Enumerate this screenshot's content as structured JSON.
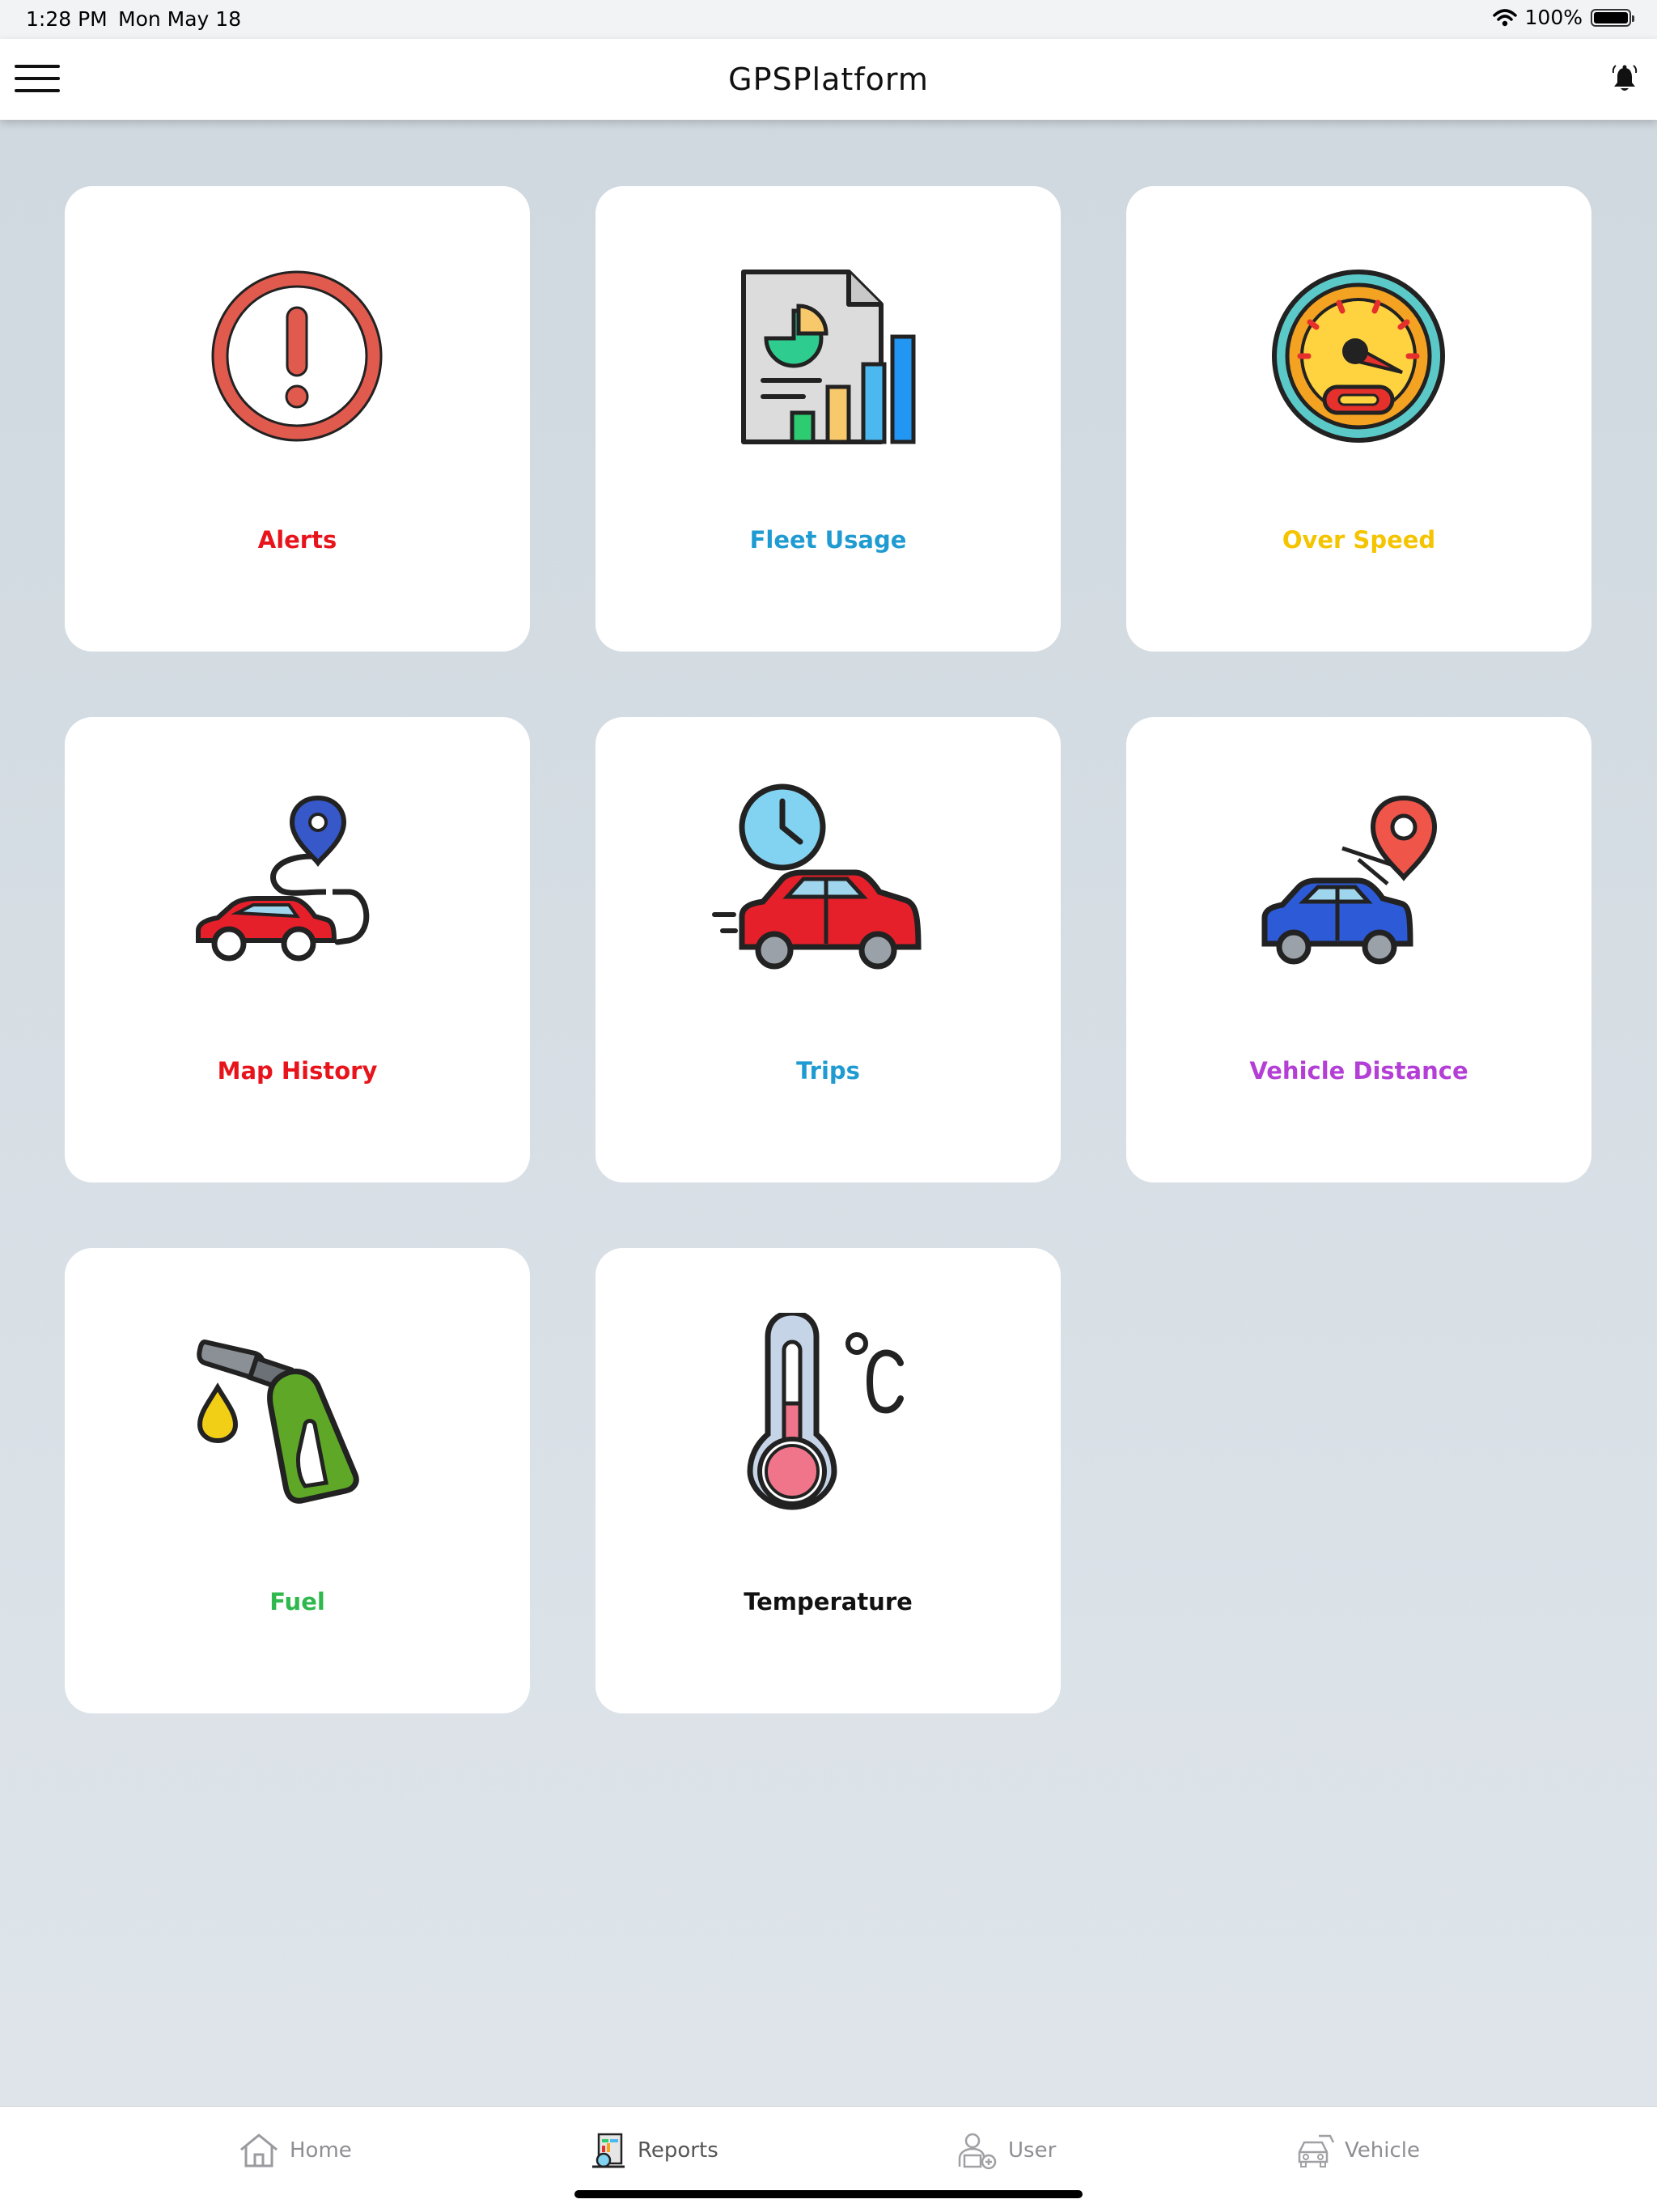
{
  "status_bar": {
    "time": "1:28 PM",
    "date": "Mon May 18",
    "battery": "100%"
  },
  "header": {
    "title": "GPSPlatform",
    "menu_icon": "hamburger-menu-icon",
    "bell_icon": "bell-icon"
  },
  "tiles": [
    {
      "label": "Alerts",
      "color": "#e8141c",
      "icon": "alert-icon"
    },
    {
      "label": "Fleet Usage",
      "color": "#1f9bd1",
      "icon": "report-chart-icon"
    },
    {
      "label": "Over Speed",
      "color": "#f5c400",
      "icon": "speedometer-icon"
    },
    {
      "label": "Map History",
      "color": "#e8141c",
      "icon": "car-route-icon"
    },
    {
      "label": "Trips",
      "color": "#1f9bd1",
      "icon": "car-clock-icon"
    },
    {
      "label": "Vehicle Distance",
      "color": "#b43fd6",
      "icon": "car-location-icon"
    },
    {
      "label": "Fuel",
      "color": "#2fb84d",
      "icon": "fuel-nozzle-icon"
    },
    {
      "label": "Temperature",
      "color": "#111111",
      "icon": "thermometer-icon"
    }
  ],
  "tab_bar": {
    "active_tab": "Reports",
    "tabs": [
      {
        "label": "Home",
        "icon": "home-icon"
      },
      {
        "label": "Reports",
        "icon": "reports-icon"
      },
      {
        "label": "User",
        "icon": "user-icon"
      },
      {
        "label": "Vehicle",
        "icon": "vehicle-icon"
      }
    ]
  }
}
